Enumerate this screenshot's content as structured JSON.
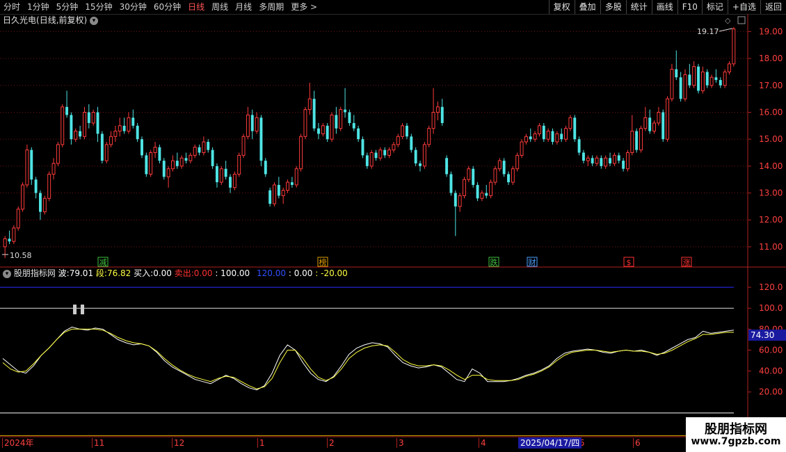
{
  "toolbar": {
    "periods": [
      "分时",
      "1分钟",
      "5分钟",
      "15分钟",
      "30分钟",
      "60分钟",
      "日线",
      "周线",
      "月线",
      "多周期",
      "更多 >"
    ],
    "active_period": "日线",
    "right_tools": [
      "复权",
      "叠加",
      "多股",
      "统计",
      "画线",
      "F10",
      "标记",
      "+自选",
      "返回"
    ]
  },
  "chart_title": {
    "stock": "日久光电",
    "mode": "(日线,前复权)"
  },
  "price_axis": [
    "19.00",
    "18.00",
    "17.00",
    "16.00",
    "15.00",
    "14.00",
    "13.00",
    "12.00",
    "11.00"
  ],
  "price_high_label": "19.17",
  "price_low_label": "10.58",
  "event_markers": [
    {
      "text": "减",
      "color": "#40c040"
    },
    {
      "text": "榜",
      "color": "#e0a000"
    },
    {
      "text": "跌",
      "color": "#40c040"
    },
    {
      "text": "财",
      "color": "#4aa0ff"
    },
    {
      "text": "$",
      "color": "#ff3030"
    },
    {
      "text": "涨",
      "color": "#ff3030"
    }
  ],
  "indicator": {
    "name": "股朋指标网",
    "wave_label": "波:",
    "wave_value": "79.01",
    "seg_label": "段:",
    "seg_value": "76.82",
    "buy_label": "买入:",
    "buy_value": "0.00",
    "sell_label": "卖出:",
    "sell_value": "0.00",
    "v100": ": 100.00",
    "v120": "120.00",
    "v0": ": 0.00",
    "vneg20": ": -20.00",
    "current_value": "74.30"
  },
  "indicator_axis": [
    "120.0",
    "100.0",
    "80.00",
    "60.00",
    "40.00",
    "20.00"
  ],
  "date_axis": {
    "labels": [
      "2024年",
      "11",
      "12",
      "1",
      "2",
      "3",
      "4",
      "5",
      "6"
    ],
    "highlight": "2025/04/17/四"
  },
  "watermark": {
    "line1": "股朋指标网",
    "line2": "www.7gpzb.com"
  },
  "chart_data": {
    "type": "candlestick",
    "candles_ohlc": [
      [
        11.0,
        11.4,
        10.58,
        11.3
      ],
      [
        11.3,
        11.6,
        11.1,
        11.2
      ],
      [
        11.2,
        11.8,
        11.1,
        11.7
      ],
      [
        11.7,
        12.5,
        11.6,
        12.4
      ],
      [
        12.4,
        13.4,
        12.3,
        13.3
      ],
      [
        13.3,
        14.8,
        13.2,
        14.6
      ],
      [
        14.6,
        14.7,
        13.3,
        13.5
      ],
      [
        13.5,
        13.6,
        12.8,
        13.0
      ],
      [
        13.0,
        13.1,
        12.0,
        12.3
      ],
      [
        12.3,
        12.9,
        12.2,
        12.8
      ],
      [
        12.8,
        13.8,
        12.7,
        13.7
      ],
      [
        13.7,
        14.3,
        13.5,
        14.1
      ],
      [
        14.1,
        14.9,
        14.0,
        14.8
      ],
      [
        14.8,
        16.3,
        14.7,
        16.2
      ],
      [
        16.2,
        16.8,
        15.8,
        15.9
      ],
      [
        15.9,
        16.0,
        14.8,
        15.0
      ],
      [
        15.0,
        15.4,
        14.9,
        15.3
      ],
      [
        15.3,
        15.5,
        15.0,
        15.1
      ],
      [
        15.1,
        16.2,
        15.0,
        16.0
      ],
      [
        16.0,
        16.3,
        15.4,
        15.6
      ],
      [
        15.6,
        16.1,
        15.5,
        16.0
      ],
      [
        16.0,
        16.2,
        14.9,
        15.2
      ],
      [
        15.2,
        15.3,
        14.1,
        14.2
      ],
      [
        14.2,
        14.9,
        14.1,
        14.8
      ],
      [
        14.8,
        15.3,
        14.7,
        15.1
      ],
      [
        15.1,
        15.5,
        14.9,
        15.3
      ],
      [
        15.3,
        15.8,
        15.1,
        15.5
      ],
      [
        15.5,
        15.8,
        15.2,
        15.3
      ],
      [
        15.3,
        16.0,
        15.2,
        15.8
      ],
      [
        15.8,
        16.1,
        15.4,
        15.5
      ],
      [
        15.5,
        15.6,
        14.9,
        15.0
      ],
      [
        15.0,
        15.1,
        14.3,
        14.4
      ],
      [
        14.4,
        14.5,
        13.6,
        13.7
      ],
      [
        13.7,
        14.6,
        13.6,
        14.5
      ],
      [
        14.5,
        14.9,
        14.3,
        14.7
      ],
      [
        14.7,
        14.8,
        14.1,
        14.2
      ],
      [
        14.2,
        14.3,
        13.5,
        13.6
      ],
      [
        13.6,
        14.0,
        13.2,
        13.9
      ],
      [
        13.9,
        14.4,
        13.8,
        14.2
      ],
      [
        14.2,
        14.5,
        13.9,
        14.0
      ],
      [
        14.0,
        14.4,
        13.9,
        14.3
      ],
      [
        14.3,
        14.5,
        14.1,
        14.2
      ],
      [
        14.2,
        14.5,
        14.1,
        14.4
      ],
      [
        14.4,
        14.8,
        14.3,
        14.7
      ],
      [
        14.7,
        14.8,
        14.4,
        14.5
      ],
      [
        14.5,
        15.1,
        14.4,
        14.9
      ],
      [
        14.9,
        15.0,
        14.5,
        14.6
      ],
      [
        14.6,
        14.7,
        13.9,
        14.0
      ],
      [
        14.0,
        14.1,
        13.2,
        13.4
      ],
      [
        13.4,
        14.0,
        13.3,
        13.9
      ],
      [
        13.9,
        14.2,
        13.5,
        13.6
      ],
      [
        13.6,
        13.7,
        13.0,
        13.2
      ],
      [
        13.2,
        13.8,
        13.1,
        13.7
      ],
      [
        13.7,
        14.5,
        13.6,
        14.4
      ],
      [
        14.4,
        15.2,
        14.3,
        15.1
      ],
      [
        15.1,
        16.2,
        15.0,
        15.9
      ],
      [
        15.9,
        16.1,
        15.0,
        15.3
      ],
      [
        15.3,
        16.0,
        15.2,
        15.8
      ],
      [
        15.8,
        15.9,
        14.0,
        14.2
      ],
      [
        14.2,
        14.3,
        13.6,
        13.7
      ],
      [
        13.1,
        13.2,
        12.5,
        12.6
      ],
      [
        12.6,
        13.4,
        12.5,
        13.3
      ],
      [
        13.3,
        13.6,
        12.8,
        12.9
      ],
      [
        12.9,
        13.2,
        12.6,
        13.1
      ],
      [
        13.1,
        13.5,
        13.0,
        13.4
      ],
      [
        13.4,
        13.6,
        13.2,
        13.3
      ],
      [
        13.3,
        14.0,
        13.2,
        13.9
      ],
      [
        13.9,
        15.2,
        13.8,
        15.1
      ],
      [
        15.1,
        16.2,
        15.0,
        16.1
      ],
      [
        16.1,
        17.1,
        15.9,
        16.5
      ],
      [
        16.5,
        16.8,
        15.3,
        15.4
      ],
      [
        15.4,
        15.6,
        15.0,
        15.2
      ],
      [
        15.2,
        15.6,
        15.1,
        15.5
      ],
      [
        15.5,
        15.6,
        14.9,
        15.0
      ],
      [
        15.0,
        16.0,
        14.9,
        15.9
      ],
      [
        15.9,
        16.2,
        15.2,
        15.4
      ],
      [
        15.4,
        16.2,
        15.3,
        16.1
      ],
      [
        16.1,
        16.9,
        15.8,
        16.0
      ],
      [
        16.0,
        16.1,
        15.5,
        15.6
      ],
      [
        15.6,
        15.9,
        15.3,
        15.4
      ],
      [
        15.4,
        15.5,
        14.9,
        15.0
      ],
      [
        15.0,
        15.1,
        14.3,
        14.4
      ],
      [
        14.4,
        14.5,
        13.9,
        14.0
      ],
      [
        14.0,
        14.6,
        13.9,
        14.5
      ],
      [
        14.5,
        14.6,
        14.2,
        14.3
      ],
      [
        14.3,
        14.7,
        14.2,
        14.6
      ],
      [
        14.6,
        14.7,
        14.3,
        14.4
      ],
      [
        14.4,
        14.7,
        14.3,
        14.6
      ],
      [
        14.6,
        14.9,
        14.5,
        14.8
      ],
      [
        14.8,
        15.2,
        14.7,
        15.1
      ],
      [
        15.1,
        15.6,
        15.0,
        15.5
      ],
      [
        15.5,
        15.6,
        15.0,
        15.1
      ],
      [
        15.1,
        15.2,
        14.5,
        14.6
      ],
      [
        14.6,
        14.7,
        14.0,
        14.1
      ],
      [
        14.1,
        14.2,
        13.8,
        14.0
      ],
      [
        14.0,
        14.9,
        13.9,
        14.8
      ],
      [
        14.8,
        15.5,
        14.7,
        15.4
      ],
      [
        15.4,
        16.9,
        15.2,
        16.0
      ],
      [
        16.0,
        16.4,
        15.7,
        16.2
      ],
      [
        16.2,
        16.5,
        15.5,
        15.6
      ],
      [
        14.3,
        14.4,
        13.6,
        13.7
      ],
      [
        13.7,
        13.8,
        12.9,
        13.0
      ],
      [
        13.0,
        13.1,
        11.4,
        12.5
      ],
      [
        12.5,
        13.0,
        12.3,
        12.9
      ],
      [
        12.9,
        13.6,
        12.8,
        13.5
      ],
      [
        13.5,
        14.0,
        13.4,
        13.9
      ],
      [
        13.9,
        14.0,
        13.2,
        13.3
      ],
      [
        13.3,
        13.4,
        12.7,
        12.8
      ],
      [
        12.8,
        13.1,
        12.7,
        13.0
      ],
      [
        13.0,
        13.3,
        12.8,
        12.9
      ],
      [
        12.9,
        13.5,
        12.8,
        13.4
      ],
      [
        13.4,
        14.0,
        13.3,
        13.9
      ],
      [
        13.9,
        14.3,
        13.8,
        14.2
      ],
      [
        14.2,
        14.3,
        13.6,
        13.7
      ],
      [
        13.7,
        13.8,
        13.3,
        13.4
      ],
      [
        13.4,
        14.0,
        13.3,
        13.9
      ],
      [
        13.9,
        14.5,
        13.8,
        14.4
      ],
      [
        14.4,
        15.0,
        14.3,
        14.9
      ],
      [
        14.9,
        15.2,
        14.8,
        15.1
      ],
      [
        15.1,
        15.4,
        14.9,
        15.0
      ],
      [
        15.0,
        15.3,
        14.9,
        15.2
      ],
      [
        15.2,
        15.6,
        15.1,
        15.5
      ],
      [
        15.5,
        15.6,
        14.9,
        15.0
      ],
      [
        15.0,
        15.4,
        14.9,
        15.3
      ],
      [
        15.3,
        15.4,
        14.8,
        14.9
      ],
      [
        14.9,
        15.3,
        14.8,
        15.2
      ],
      [
        15.2,
        15.4,
        14.9,
        15.0
      ],
      [
        15.0,
        15.5,
        14.9,
        15.4
      ],
      [
        15.4,
        15.9,
        15.3,
        15.8
      ],
      [
        15.8,
        15.9,
        14.9,
        15.0
      ],
      [
        15.0,
        15.1,
        14.4,
        14.5
      ],
      [
        14.5,
        14.6,
        14.1,
        14.2
      ],
      [
        14.2,
        14.4,
        14.0,
        14.3
      ],
      [
        14.3,
        14.4,
        14.0,
        14.1
      ],
      [
        14.1,
        14.4,
        14.0,
        14.3
      ],
      [
        14.3,
        14.4,
        13.9,
        14.0
      ],
      [
        14.0,
        14.4,
        13.9,
        14.3
      ],
      [
        14.3,
        14.5,
        14.0,
        14.1
      ],
      [
        14.1,
        14.5,
        14.0,
        14.4
      ],
      [
        14.4,
        14.5,
        14.1,
        14.2
      ],
      [
        14.2,
        14.3,
        13.8,
        13.9
      ],
      [
        13.9,
        14.6,
        13.8,
        14.5
      ],
      [
        14.5,
        15.9,
        14.4,
        15.3
      ],
      [
        15.3,
        15.4,
        14.5,
        14.6
      ],
      [
        14.6,
        15.5,
        14.5,
        15.4
      ],
      [
        15.4,
        16.2,
        15.3,
        15.8
      ],
      [
        15.8,
        16.1,
        15.2,
        15.3
      ],
      [
        15.3,
        15.7,
        15.2,
        15.6
      ],
      [
        15.6,
        16.2,
        15.5,
        16.0
      ],
      [
        16.0,
        16.1,
        14.9,
        15.0
      ],
      [
        15.0,
        16.6,
        14.9,
        16.5
      ],
      [
        16.5,
        17.8,
        16.4,
        17.6
      ],
      [
        17.6,
        18.3,
        17.2,
        17.3
      ],
      [
        17.3,
        17.5,
        16.4,
        16.5
      ],
      [
        16.5,
        17.6,
        16.4,
        17.4
      ],
      [
        17.4,
        17.8,
        16.9,
        17.0
      ],
      [
        17.0,
        17.9,
        16.9,
        17.7
      ],
      [
        17.7,
        17.8,
        16.7,
        16.8
      ],
      [
        16.8,
        17.7,
        16.7,
        17.5
      ],
      [
        17.5,
        17.6,
        16.9,
        17.0
      ],
      [
        17.0,
        17.4,
        16.9,
        17.3
      ],
      [
        17.3,
        17.6,
        17.1,
        17.2
      ],
      [
        17.2,
        17.3,
        16.9,
        17.0
      ],
      [
        17.0,
        17.6,
        16.9,
        17.5
      ],
      [
        17.5,
        17.9,
        17.4,
        17.8
      ],
      [
        17.8,
        19.17,
        17.7,
        19.1
      ]
    ],
    "up_color": "#ff3b3b",
    "down_color": "#4fe4e4",
    "ylim": [
      10.58,
      19.17
    ],
    "indicator_ylim": [
      -20,
      130
    ],
    "indicator_levels": [
      120,
      100,
      0
    ],
    "indicator_series": [
      {
        "name": "波",
        "color": "#ffffff",
        "values": [
          52,
          46,
          40,
          38,
          45,
          55,
          62,
          70,
          78,
          82,
          80,
          79,
          81,
          80,
          75,
          70,
          67,
          65,
          66,
          64,
          58,
          50,
          44,
          40,
          36,
          32,
          30,
          28,
          32,
          36,
          33,
          28,
          24,
          22,
          26,
          38,
          55,
          65,
          60,
          48,
          38,
          32,
          30,
          35,
          45,
          56,
          62,
          65,
          67,
          66,
          63,
          55,
          48,
          45,
          43,
          44,
          46,
          44,
          38,
          32,
          30,
          42,
          38,
          30,
          30,
          30,
          31,
          33,
          36,
          38,
          41,
          45,
          52,
          57,
          59,
          60,
          61,
          60,
          58,
          57,
          59,
          60,
          59,
          60,
          58,
          55,
          58,
          62,
          66,
          70,
          72,
          78,
          76,
          77,
          78,
          79
        ]
      },
      {
        "name": "段",
        "color": "#ffff40",
        "values": [
          48,
          42,
          39,
          40,
          47,
          55,
          62,
          70,
          77,
          80,
          80,
          80,
          80,
          79,
          76,
          72,
          69,
          67,
          66,
          64,
          59,
          52,
          46,
          41,
          37,
          34,
          32,
          30,
          33,
          35,
          34,
          30,
          26,
          23,
          25,
          33,
          48,
          60,
          60,
          52,
          42,
          34,
          31,
          34,
          42,
          52,
          58,
          62,
          64,
          65,
          64,
          58,
          51,
          47,
          45,
          45,
          46,
          45,
          41,
          36,
          32,
          36,
          36,
          32,
          31,
          31,
          31,
          32,
          35,
          37,
          40,
          44,
          50,
          55,
          58,
          59,
          60,
          60,
          59,
          58,
          59,
          60,
          59,
          59,
          58,
          56,
          57,
          60,
          64,
          68,
          71,
          75,
          75,
          76,
          77,
          77
        ]
      }
    ]
  }
}
